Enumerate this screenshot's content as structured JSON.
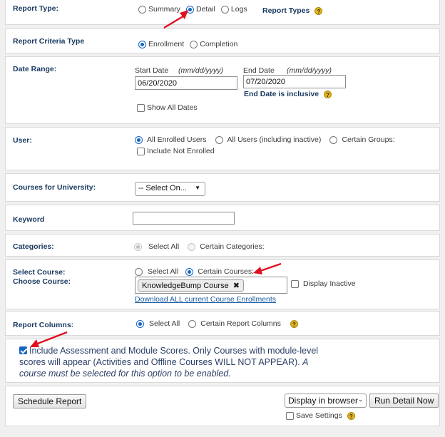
{
  "report_type": {
    "label": "Report Type:",
    "options": [
      "Summary",
      "Detail",
      "Logs"
    ],
    "selected": "Detail",
    "types_label": "Report Types"
  },
  "criteria_type": {
    "label": "Report Criteria Type",
    "options": [
      "Enrollment",
      "Completion"
    ],
    "selected": "Enrollment"
  },
  "date_range": {
    "label": "Date Range:",
    "start_label": "Start Date",
    "start_format": "(mm/dd/yyyy)",
    "start_value": "06/20/2020",
    "end_label": "End Date",
    "end_format": "(mm/dd/yyyy)",
    "end_value": "07/20/2020",
    "end_note": "End Date is inclusive",
    "show_all_label": "Show All Dates"
  },
  "user": {
    "label": "User:",
    "options": [
      "All Enrolled Users",
      "All Users (including inactive)",
      "Certain Groups:"
    ],
    "selected": "All Enrolled Users",
    "include_not_enrolled": "Include Not Enrolled"
  },
  "courses_for_university": {
    "label": "Courses for University:",
    "select_value": "-- Select On..."
  },
  "keyword": {
    "label": "Keyword",
    "value": ""
  },
  "categories": {
    "label": "Categories:",
    "options": [
      "Select All",
      "Certain Categories:"
    ]
  },
  "course": {
    "label_line1": "Select Course:",
    "label_line2": "Choose Course:",
    "options": [
      "Select All",
      "Certain Courses:"
    ],
    "selected": "Certain Courses:",
    "chip": "KnowledgeBump Course",
    "display_inactive": "Display Inactive",
    "download_link": "Download ALL current Course Enrollments"
  },
  "report_columns": {
    "label": "Report Columns:",
    "options": [
      "Select All",
      "Certain Report Columns"
    ],
    "selected": "Select All"
  },
  "assessment": {
    "checked": true,
    "text": "Include Assessment and Module Scores. Only Courses with module-level scores will appear (Activities and Offline Courses WILL NOT APPEAR).",
    "note": "A course must be selected for this option to be enabled."
  },
  "actions": {
    "schedule": "Schedule Report",
    "display_select": "Display in browser",
    "run": "Run Detail Now",
    "save_settings": "Save Settings"
  },
  "help_glyph": "?",
  "colors": {
    "label": "#1b3b61",
    "accent": "#1565c0",
    "arrow": "#e0101f",
    "help": "#e3b61e"
  }
}
